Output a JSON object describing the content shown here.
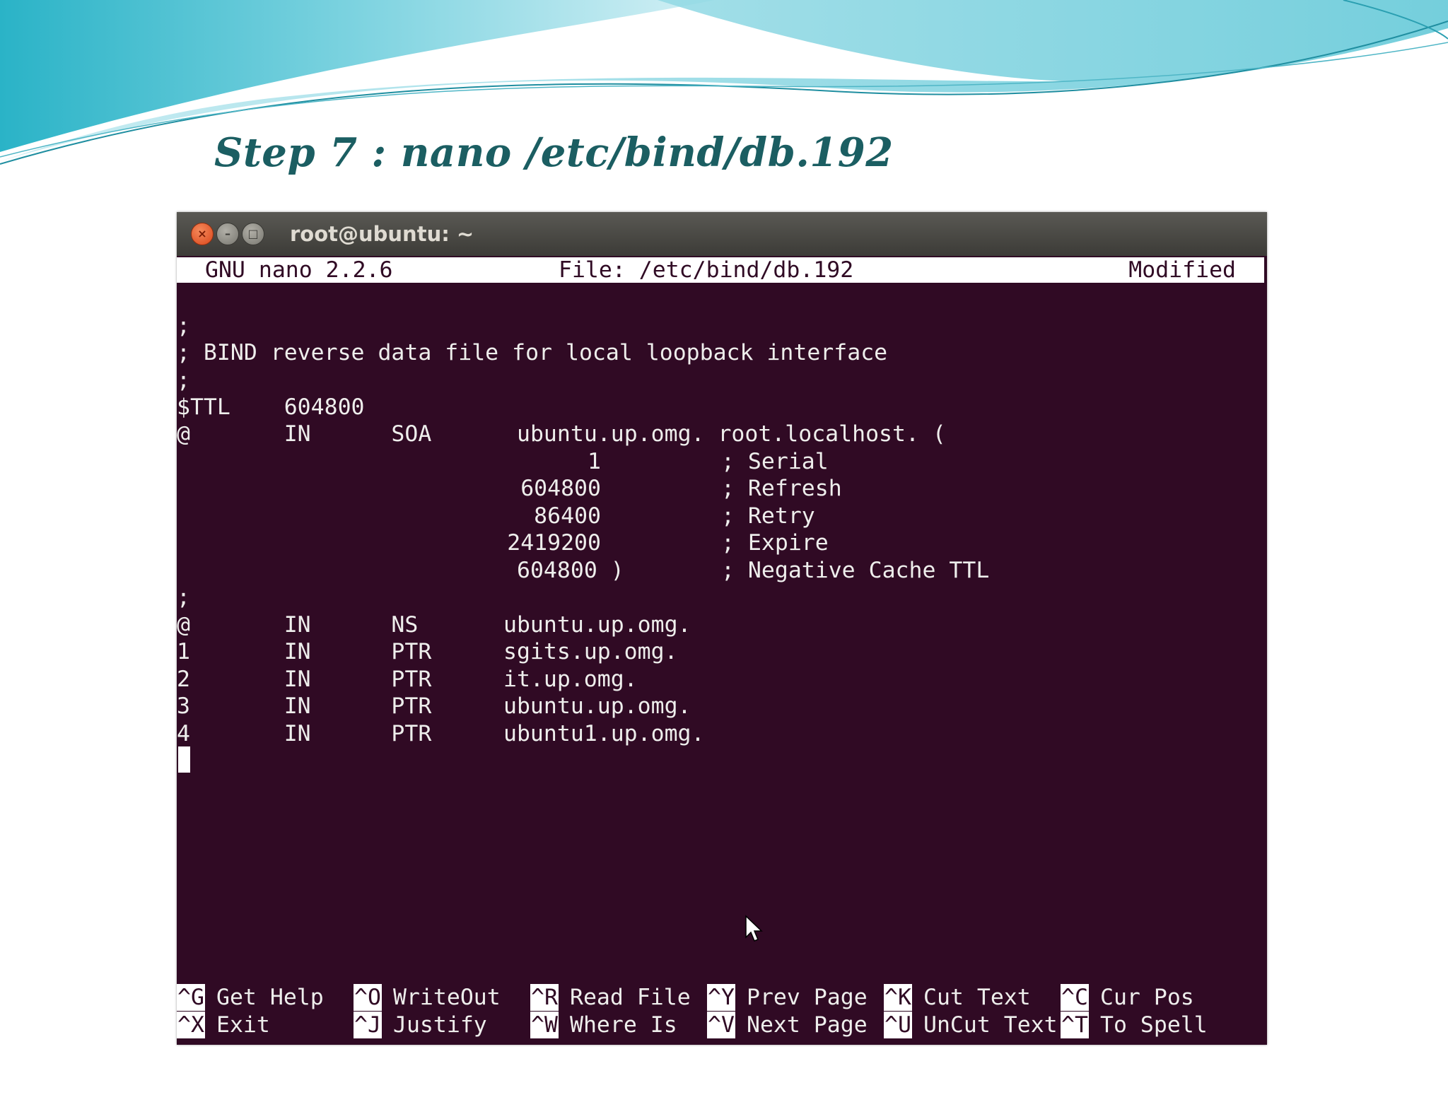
{
  "slide": {
    "title": "Step 7 : nano /etc/bind/db.192"
  },
  "window": {
    "title": "root@ubuntu: ~",
    "close_glyph": "×",
    "min_glyph": "–",
    "max_glyph": "□"
  },
  "nano": {
    "version": "GNU nano 2.2.6",
    "file": "File: /etc/bind/db.192",
    "status": "Modified"
  },
  "lines": [
    ";",
    "; BIND reverse data file for local loopback interface",
    ";",
    "$TTL    604800",
    "@       IN      SOA",
    "",
    "",
    "",
    "",
    "",
    ";",
    "@       IN      NS",
    "1       IN      PTR",
    "2       IN      PTR",
    "3       IN      PTR",
    "4       IN      PTR"
  ],
  "soa": {
    "primary": "ubuntu.up.omg. root.localhost. (",
    "values": [
      "1",
      "604800",
      "86400",
      "2419200",
      "604800 )"
    ],
    "comments": [
      "; Serial",
      "; Refresh",
      "; Retry",
      "; Expire",
      "; Negative Cache TTL"
    ]
  },
  "records_data": [
    "ubuntu.up.omg.",
    "sgits.up.omg.",
    "it.up.omg.",
    "ubuntu.up.omg.",
    "ubuntu1.up.omg."
  ],
  "shortcuts": [
    {
      "key": "^G",
      "label": "Get Help"
    },
    {
      "key": "^O",
      "label": "WriteOut"
    },
    {
      "key": "^R",
      "label": "Read File"
    },
    {
      "key": "^Y",
      "label": "Prev Page"
    },
    {
      "key": "^K",
      "label": "Cut Text"
    },
    {
      "key": "^C",
      "label": "Cur Pos"
    },
    {
      "key": "^X",
      "label": "Exit"
    },
    {
      "key": "^J",
      "label": "Justify"
    },
    {
      "key": "^W",
      "label": "Where Is"
    },
    {
      "key": "^V",
      "label": "Next Page"
    },
    {
      "key": "^U",
      "label": "UnCut Text"
    },
    {
      "key": "^T",
      "label": "To Spell"
    }
  ]
}
